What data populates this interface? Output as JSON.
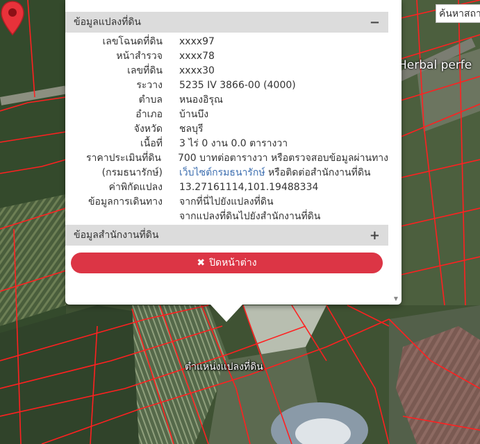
{
  "map": {
    "place_label": "Herbal perfe",
    "search_placeholder": "ค้นหาสถา",
    "marker_label": "ตำแหน่งแปลงที่ดิน",
    "boundary_color": "#ff2020",
    "marker_color": "#e8323a"
  },
  "popup": {
    "section1_title": "ข้อมูลแปลงที่ดิน",
    "section1_toggle": "−",
    "section2_title": "ข้อมูลสำนักงานที่ดิน",
    "section2_toggle": "+",
    "rows": [
      {
        "label": "เลขโฉนดที่ดิน",
        "value": "xxxx97"
      },
      {
        "label": "หน้าสำรวจ",
        "value": "xxxx78"
      },
      {
        "label": "เลขที่ดิน",
        "value": "xxxx30"
      },
      {
        "label": "ระวาง",
        "value": "5235 IV 3866-00 (4000)"
      },
      {
        "label": "ตำบล",
        "value": "หนองอิรุณ"
      },
      {
        "label": "อำเภอ",
        "value": "บ้านบึง"
      },
      {
        "label": "จังหวัด",
        "value": "ชลบุรี"
      },
      {
        "label": "เนื้อที่",
        "value": "3 ไร่ 0 งาน 0.0 ตารางวา"
      }
    ],
    "price_label": "ราคาประเมินที่ดิน",
    "price_value": "700 บาทต่อตารางวา หรือตรวจสอบข้อมูลผ่านทาง",
    "dept_label": "(กรมธนารักษ์)",
    "dept_link": "เว็บไซต์กรมธนารักษ์",
    "dept_rest": " หรือติดต่อสำนักงานที่ดิน",
    "coord_label": "ค่าพิกัดแปลง",
    "coord_value": "13.27161114,101.19488334",
    "travel_label": "ข้อมูลการเดินทาง",
    "travel_link1": "จากที่นี่ไปยังแปลงที่ดิน",
    "travel_link2": "จากแปลงที่ดินไปยังสำนักงานที่ดิน",
    "close_icon": "times-icon",
    "close_label": "ปิดหน้าต่าง"
  }
}
